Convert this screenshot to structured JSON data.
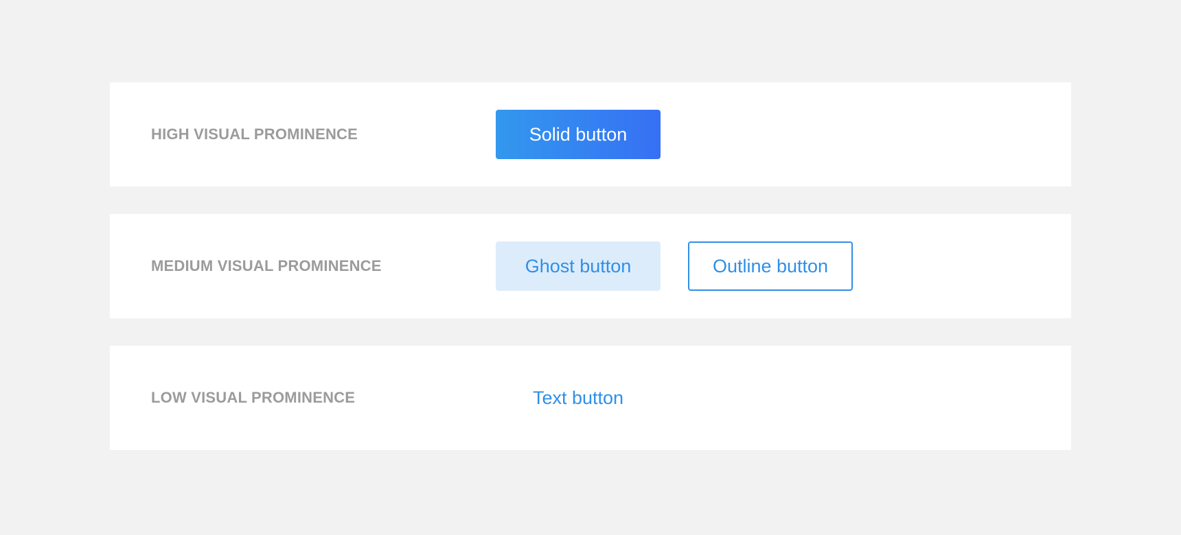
{
  "colors": {
    "page_background": "#f2f2f2",
    "card_background": "#ffffff",
    "label_text": "#9b9b9b",
    "primary_blue": "#2f8fe8",
    "solid_gradient_start": "#3398ee",
    "solid_gradient_end": "#3670f4",
    "ghost_background": "#ddecfb"
  },
  "sections": [
    {
      "label": "HIGH VISUAL PROMINENCE",
      "buttons": [
        {
          "label": "Solid button",
          "style": "solid"
        }
      ]
    },
    {
      "label": "MEDIUM VISUAL PROMINENCE",
      "buttons": [
        {
          "label": "Ghost button",
          "style": "ghost"
        },
        {
          "label": "Outline button",
          "style": "outline"
        }
      ]
    },
    {
      "label": "LOW VISUAL PROMINENCE",
      "buttons": [
        {
          "label": "Text button",
          "style": "text"
        }
      ]
    }
  ]
}
